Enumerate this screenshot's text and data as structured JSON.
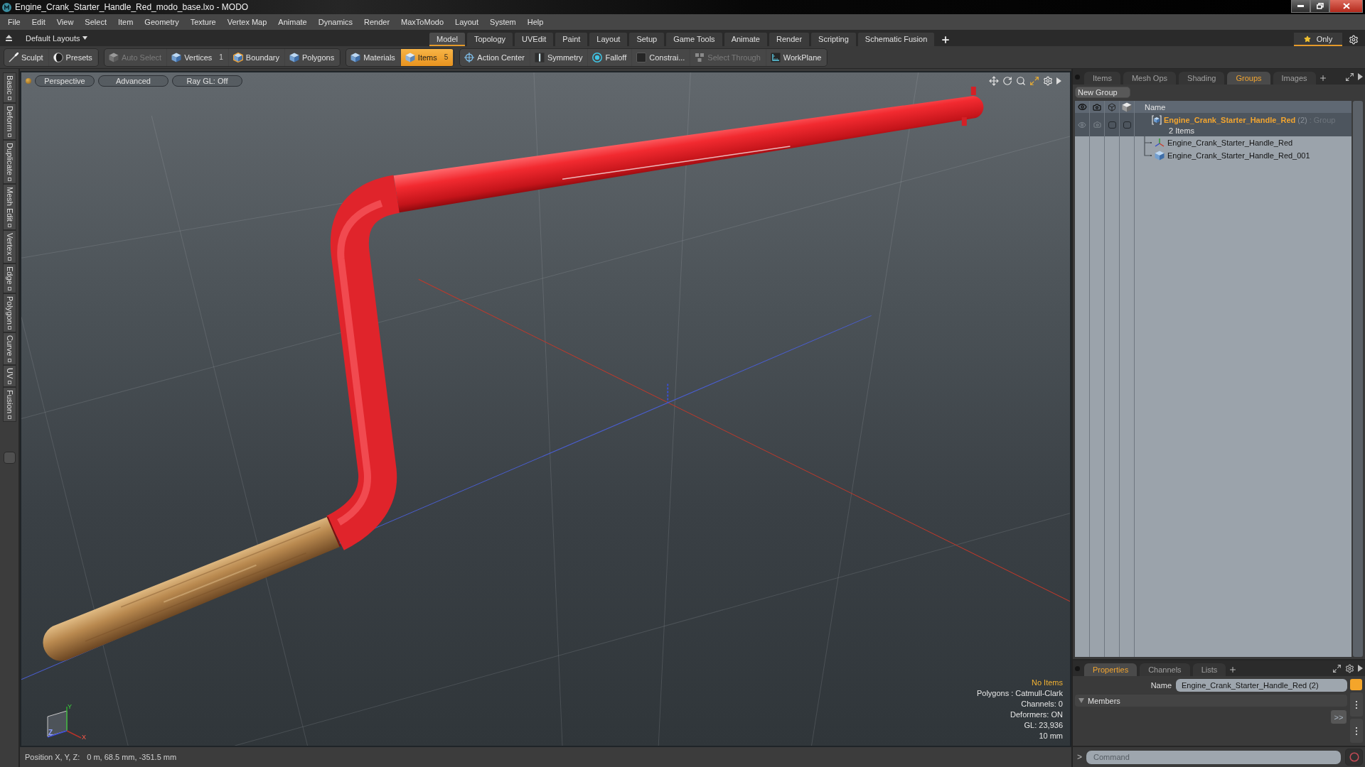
{
  "window": {
    "title": "Engine_Crank_Starter_Handle_Red_modo_base.lxo - MODO"
  },
  "menu": [
    "File",
    "Edit",
    "View",
    "Select",
    "Item",
    "Geometry",
    "Texture",
    "Vertex Map",
    "Animate",
    "Dynamics",
    "Render",
    "MaxToModo",
    "Layout",
    "System",
    "Help"
  ],
  "layout_bar": {
    "layouts_menu": "Default Layouts",
    "tabs": [
      {
        "label": "Model",
        "selected": true
      },
      {
        "label": "Topology",
        "selected": false
      },
      {
        "label": "UVEdit",
        "selected": false
      },
      {
        "label": "Paint",
        "selected": false
      },
      {
        "label": "Layout",
        "selected": false
      },
      {
        "label": "Setup",
        "selected": false
      },
      {
        "label": "Game Tools",
        "selected": false
      },
      {
        "label": "Animate",
        "selected": false
      },
      {
        "label": "Render",
        "selected": false
      },
      {
        "label": "Scripting",
        "selected": false
      },
      {
        "label": "Schematic Fusion",
        "selected": false
      }
    ],
    "only_button": "Only"
  },
  "toolbar": {
    "groups": [
      [
        {
          "label": "Sculpt",
          "selected": false,
          "disabled": false
        },
        {
          "label": "Presets",
          "selected": false,
          "disabled": false
        }
      ],
      [
        {
          "label": "Auto Select",
          "selected": false,
          "disabled": true
        },
        {
          "label": "Vertices",
          "count": "1",
          "selected": false,
          "disabled": false
        },
        {
          "label": "Boundary",
          "selected": false,
          "disabled": false
        },
        {
          "label": "Polygons",
          "selected": false,
          "disabled": false
        }
      ],
      [
        {
          "label": "Materials",
          "selected": false,
          "disabled": false
        },
        {
          "label": "Items",
          "count": "5",
          "selected": true,
          "disabled": false
        }
      ],
      [
        {
          "label": "Action Center",
          "selected": false,
          "disabled": false
        },
        {
          "label": "Symmetry",
          "selected": false,
          "disabled": false
        },
        {
          "label": "Falloff",
          "selected": false,
          "disabled": false
        },
        {
          "label": "Constrai...",
          "selected": false,
          "disabled": false
        },
        {
          "label": "Select Through",
          "selected": false,
          "disabled": true
        },
        {
          "label": "WorkPlane",
          "selected": false,
          "disabled": false
        }
      ]
    ]
  },
  "side_tabs": [
    "Basic",
    "Deform",
    "Duplicate",
    "Mesh Edit",
    "Vertex",
    "Edge",
    "Polygon",
    "Curve",
    "UV",
    "Fusion"
  ],
  "viewport": {
    "view_button": "Perspective",
    "shading_button": "Advanced",
    "raygl_button": "Ray GL: Off",
    "axis_labels": {
      "x": "X",
      "y": "Y",
      "z": "Z"
    },
    "info": {
      "selection": "No Items",
      "lines": [
        "Polygons : Catmull-Clark",
        "Channels: 0",
        "Deformers: ON",
        "GL: 23,936",
        "10 mm"
      ]
    }
  },
  "status_bar": {
    "label": "Position X, Y, Z:",
    "value": "0 m, 68.5 mm, -351.5 mm"
  },
  "items_panel": {
    "tabs": [
      {
        "label": "Items",
        "selected": false
      },
      {
        "label": "Mesh Ops",
        "selected": false
      },
      {
        "label": "Shading",
        "selected": false
      },
      {
        "label": "Groups",
        "selected": true
      },
      {
        "label": "Images",
        "selected": false
      }
    ],
    "new_group_button": "New Group",
    "name_column": "Name",
    "group": {
      "name": "Engine_Crank_Starter_Handle_Red",
      "count": "(2)",
      "type": ": Group",
      "summary": "2 Items",
      "selected": true,
      "children": [
        {
          "name": "Engine_Crank_Starter_Handle_Red",
          "kind": "locator",
          "selected": false
        },
        {
          "name": "Engine_Crank_Starter_Handle_Red_001",
          "kind": "mesh",
          "selected": false
        }
      ]
    }
  },
  "properties_panel": {
    "tabs": [
      {
        "label": "Properties",
        "selected": true
      },
      {
        "label": "Channels",
        "selected": false
      },
      {
        "label": "Lists",
        "selected": false
      }
    ],
    "name_label": "Name",
    "name_value": "Engine_Crank_Starter_Handle_Red (2)",
    "section": "Members",
    "members_button": ">>"
  },
  "command_bar": {
    "prompt": ">",
    "placeholder": "Command"
  }
}
